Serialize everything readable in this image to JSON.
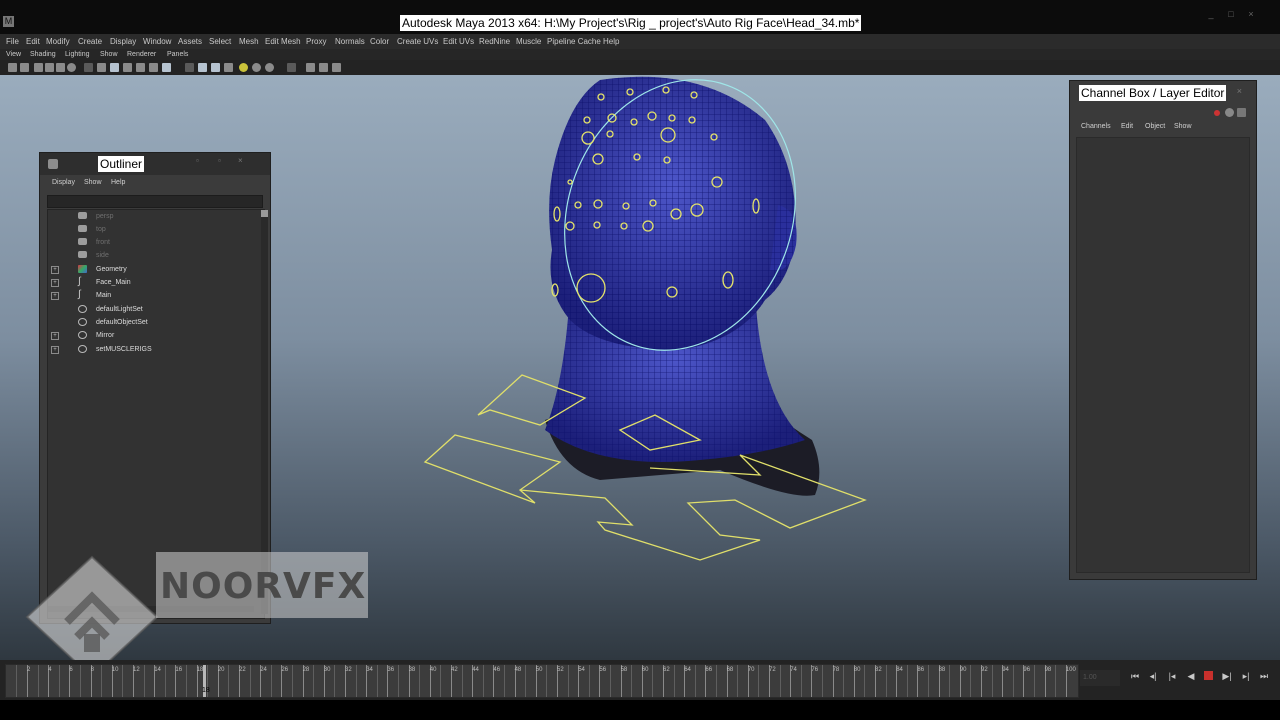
{
  "window": {
    "title": "Autodesk Maya 2013 x64: H:\\My Project's\\Rig _ project's\\Auto Rig Face\\Head_34.mb*"
  },
  "menubar": [
    "File",
    "Edit",
    "Modify",
    "Create",
    "Display",
    "Window",
    "Assets",
    "Select",
    "Mesh",
    "Edit Mesh",
    "Proxy",
    "Normals",
    "Color",
    "Create UVs",
    "Edit UVs",
    "RedNine",
    "Muscle",
    "Pipeline Cache",
    "Help"
  ],
  "panel_menu": [
    "View",
    "Shading",
    "Lighting",
    "Show",
    "Renderer",
    "Panels"
  ],
  "outliner": {
    "title": "Outliner",
    "menu": [
      "Display",
      "Show",
      "Help"
    ],
    "items": [
      {
        "label": "persp",
        "icon": "camera-icon",
        "expandable": false,
        "dim": true
      },
      {
        "label": "top",
        "icon": "camera-icon",
        "expandable": false,
        "dim": true
      },
      {
        "label": "front",
        "icon": "camera-icon",
        "expandable": false,
        "dim": true
      },
      {
        "label": "side",
        "icon": "camera-icon",
        "expandable": false,
        "dim": true
      },
      {
        "label": "Geometry",
        "icon": "geometry-icon",
        "expandable": true,
        "dim": false
      },
      {
        "label": "Face_Main",
        "icon": "curve-icon",
        "expandable": true,
        "dim": false
      },
      {
        "label": "Main",
        "icon": "curve-icon",
        "expandable": true,
        "dim": false
      },
      {
        "label": "defaultLightSet",
        "icon": "set-icon",
        "expandable": false,
        "dim": false
      },
      {
        "label": "defaultObjectSet",
        "icon": "set-icon",
        "expandable": false,
        "dim": false
      },
      {
        "label": "Mirror",
        "icon": "set-icon",
        "expandable": true,
        "dim": false
      },
      {
        "label": "setMUSCLERIGS",
        "icon": "set-icon",
        "expandable": true,
        "dim": false
      }
    ]
  },
  "channel_box": {
    "title": "Channel Box / Layer Editor",
    "menu": [
      "Channels",
      "Edit",
      "Object",
      "Show"
    ]
  },
  "watermark": {
    "text": "NOORVFX"
  },
  "timeline": {
    "tick_labels": [
      "2",
      "4",
      "6",
      "8",
      "10",
      "12",
      "14",
      "16",
      "18",
      "20",
      "22",
      "24",
      "26",
      "28",
      "30",
      "32",
      "34",
      "36",
      "38",
      "40",
      "42",
      "44",
      "46",
      "48",
      "50",
      "52",
      "54",
      "56",
      "58",
      "60",
      "62",
      "64",
      "66",
      "68",
      "70",
      "72",
      "74",
      "76",
      "78",
      "80",
      "82",
      "84",
      "86",
      "88",
      "90",
      "92",
      "94",
      "96",
      "98",
      "100"
    ],
    "current_frame": "18",
    "frame_field": "1.00"
  },
  "playback": [
    "skip-start-icon",
    "step-back-icon",
    "step-key-back-icon",
    "play-back-icon",
    "stop-icon",
    "play-forward-icon",
    "skip-end-icon"
  ],
  "colors": {
    "viewport_top": "#9aacbd",
    "viewport_bottom": "#2f3840",
    "mesh": "#1c1f8a",
    "controls": "#d6d46a"
  }
}
